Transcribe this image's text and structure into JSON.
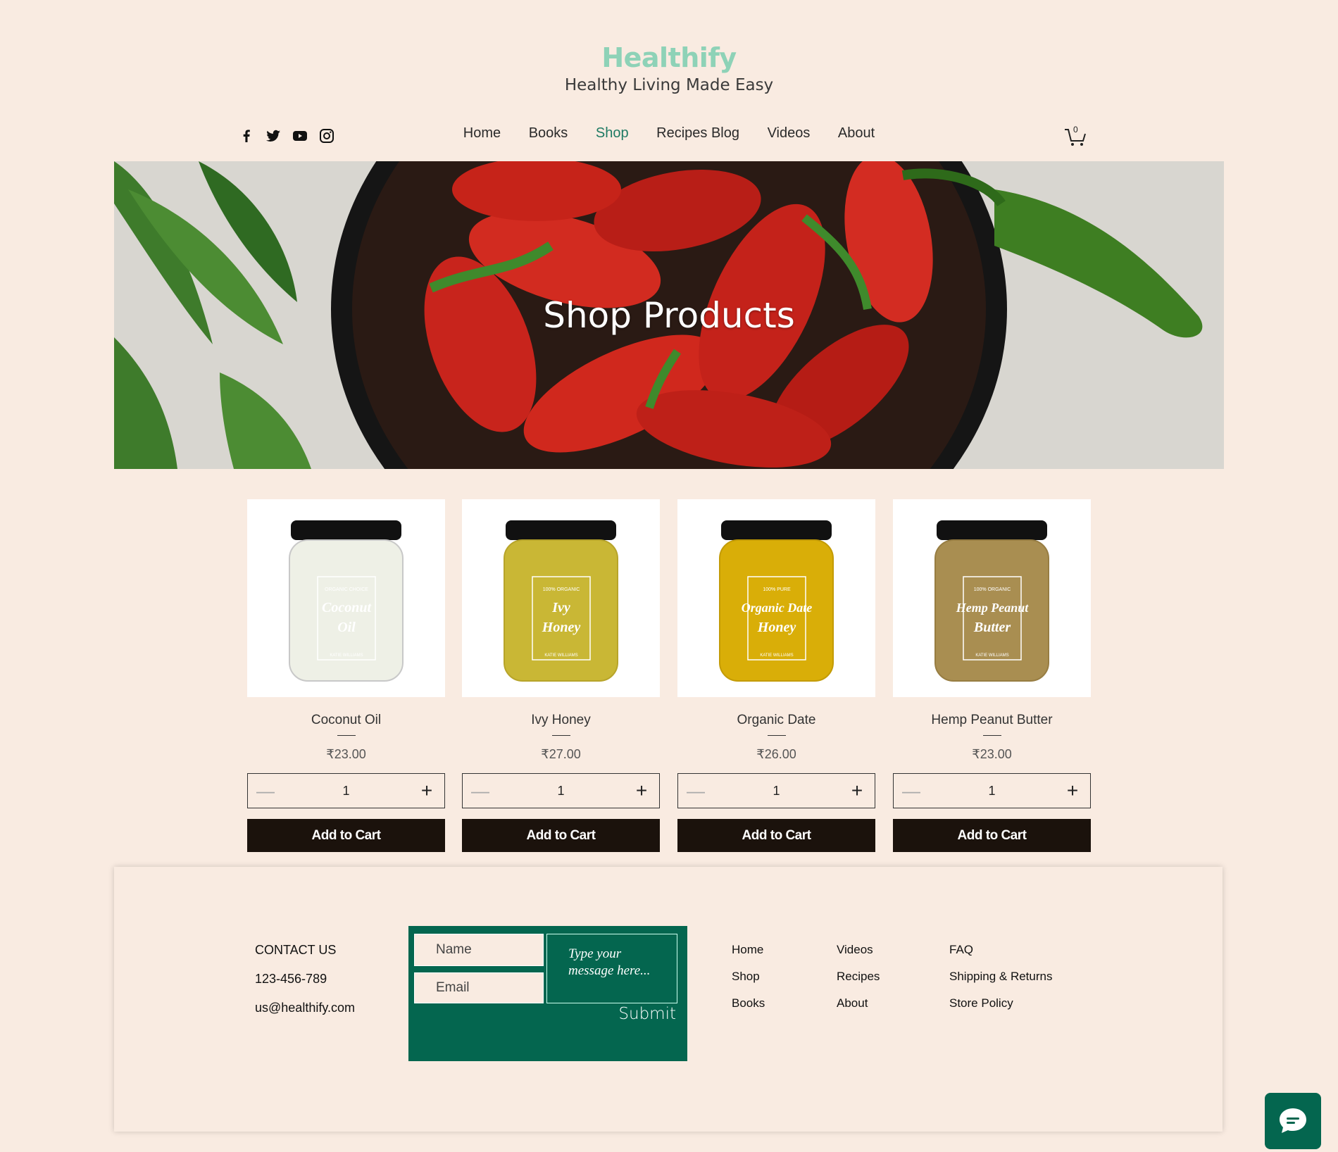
{
  "brand": {
    "name": "Healthify",
    "tagline": "Healthy Living Made Easy"
  },
  "social": [
    "facebook-icon",
    "twitter-icon",
    "youtube-icon",
    "instagram-icon"
  ],
  "nav": {
    "items": [
      {
        "label": "Home"
      },
      {
        "label": "Books"
      },
      {
        "label": "Shop"
      },
      {
        "label": "Recipes Blog"
      },
      {
        "label": "Videos"
      },
      {
        "label": "About"
      }
    ],
    "active": "Shop"
  },
  "cart": {
    "count": "0"
  },
  "hero": {
    "title": "Shop Products"
  },
  "products": [
    {
      "name": "Coconut Oil",
      "price": "₹23.00",
      "qty": "1",
      "button": "Add to Cart",
      "label_top": "ORGANIC CHOICE",
      "label_line1": "Coconut",
      "label_line2": "Oil",
      "label_bottom": "KATIE WILLIAMS",
      "fill": "#EEF0E6"
    },
    {
      "name": "Ivy Honey",
      "price": "₹27.00",
      "qty": "1",
      "button": "Add to Cart",
      "label_top": "100% ORGANIC",
      "label_line1": "Ivy",
      "label_line2": "Honey",
      "label_bottom": "KATIE WILLIAMS",
      "fill": "#C9B735"
    },
    {
      "name": "Organic Date",
      "price": "₹26.00",
      "qty": "1",
      "button": "Add to Cart",
      "label_top": "100% PURE",
      "label_line1": "Organic Date",
      "label_line2": "Honey",
      "label_bottom": "KATIE WILLIAMS",
      "fill": "#D9AE08"
    },
    {
      "name": "Hemp Peanut Butter",
      "price": "₹23.00",
      "qty": "1",
      "button": "Add to Cart",
      "label_top": "100% ORGANIC",
      "label_line1": "Hemp Peanut",
      "label_line2": "Butter",
      "label_bottom": "KATIE WILLIAMS",
      "fill": "#A98E51"
    }
  ],
  "footer": {
    "contact": {
      "heading": "CONTACT US",
      "phone": "123-456-789",
      "email": "us@healthify.com"
    },
    "form": {
      "name_placeholder": "Name",
      "email_placeholder": "Email",
      "message_placeholder": "Type your message here...",
      "submit": "Submit"
    },
    "links_col1": [
      "Home",
      "Shop",
      "Books"
    ],
    "links_col2": [
      "Videos",
      "Recipes",
      "About"
    ],
    "links_col3": [
      "FAQ",
      "Shipping & Returns",
      "Store Policy"
    ]
  },
  "colors": {
    "background": "#F9EBE1",
    "brand": "#8ED2B7",
    "accent": "#1F7A63",
    "form": "#04664F",
    "button": "#1B120C"
  }
}
